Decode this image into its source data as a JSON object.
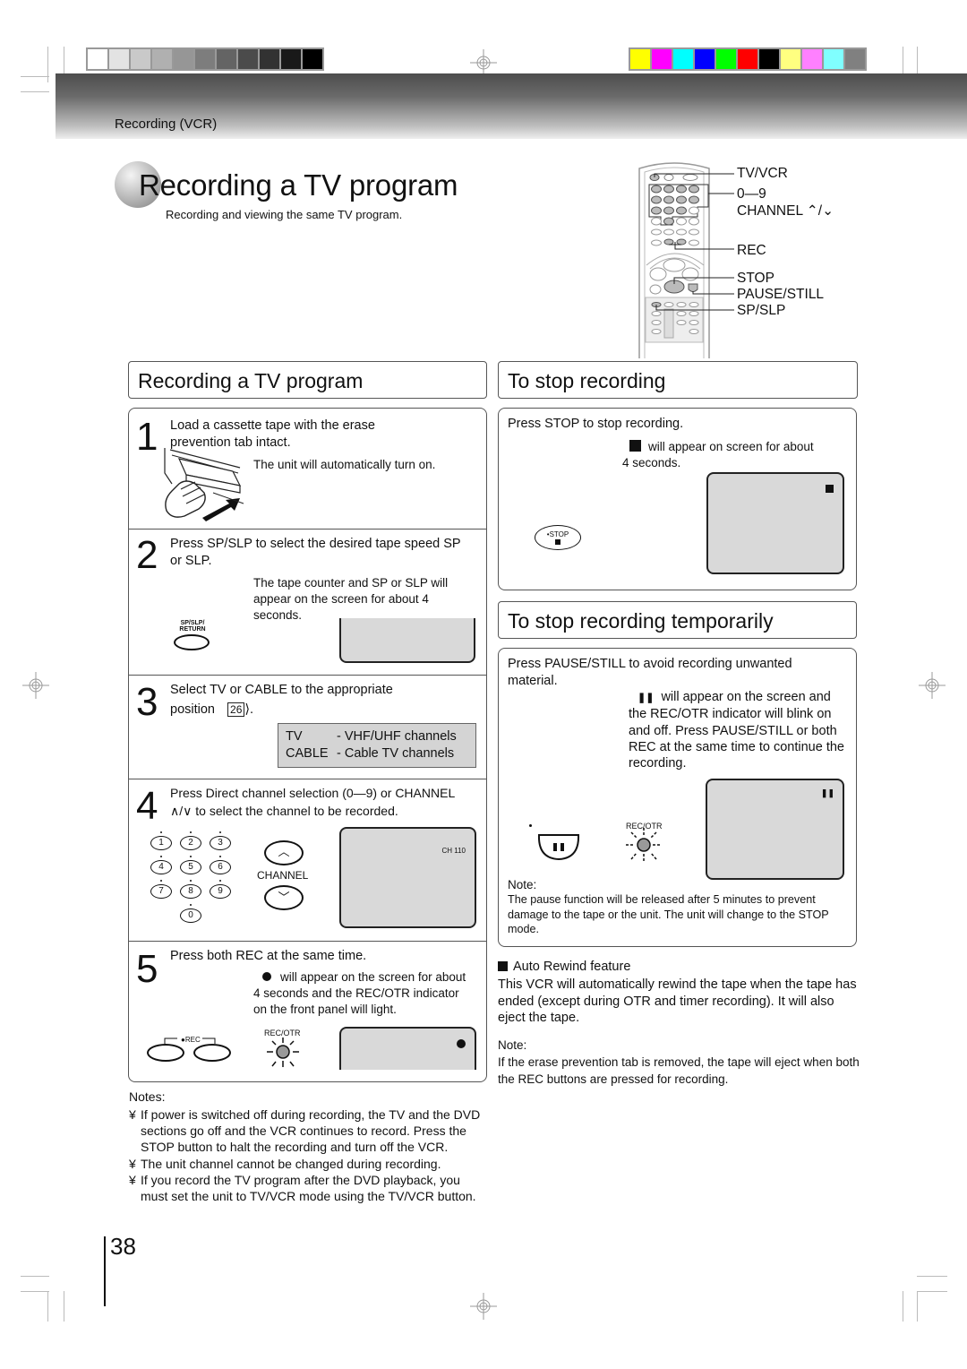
{
  "header": {
    "section_label": "Recording (VCR)",
    "grayscale_swatches": [
      "#ffffff",
      "#e3e3e3",
      "#c9c9c9",
      "#b0b0b0",
      "#969696",
      "#7d7d7d",
      "#646464",
      "#4b4b4b",
      "#323232",
      "#191919",
      "#000000"
    ],
    "color_swatches": [
      "#ffff00",
      "#ff00ff",
      "#00ffff",
      "#0000ff",
      "#00ff00",
      "#ff0000",
      "#000000",
      "#ffff80",
      "#ff80ff",
      "#80ffff",
      "#808080"
    ]
  },
  "title": {
    "main": "Recording a TV program",
    "subtitle": "Recording and viewing the same TV program."
  },
  "remote_labels": {
    "tv_vcr": "TV/VCR",
    "digits": "0—9",
    "channel": "CHANNEL ⌃/⌄",
    "rec": "REC",
    "stop": "STOP",
    "pause_still": "PAUSE/STILL",
    "sp_slp": "SP/SLP"
  },
  "recording_section": {
    "heading": "Recording a TV program",
    "steps": [
      {
        "number": "1",
        "text": "Load a cassette tape with the erase prevention tab intact.",
        "detail": "The unit will automatically turn on."
      },
      {
        "number": "2",
        "text": "Press SP/SLP to select the desired tape speed SP or SLP.",
        "detail": "The tape counter and SP or SLP will appear on the screen for about 4 seconds.",
        "button_label": "SP/SLP/ RETURN"
      },
      {
        "number": "3",
        "text_line1": "Select  TV  or  CABLE  to the appropriate",
        "text_line2": "position",
        "page_ref": "26",
        "options": [
          {
            "key": "TV",
            "desc": "- VHF/UHF channels"
          },
          {
            "key": "CABLE",
            "desc": "- Cable TV channels"
          }
        ]
      },
      {
        "number": "4",
        "text_line1": "Press Direct channel selection (0—9) or CHANNEL",
        "text_line2": "∧/∨ to select the channel to be recorded.",
        "keypad": [
          "1",
          "2",
          "3",
          "4",
          "5",
          "6",
          "7",
          "8",
          "9",
          "0"
        ],
        "channel_label": "CHANNEL",
        "screen_text": "CH  110"
      },
      {
        "number": "5",
        "text": "Press both REC at the same time.",
        "detail": "will appear on the screen for about 4 seconds and the REC/OTR indicator on the front panel will light.",
        "rec_label": "●REC",
        "indicator_label": "REC/OTR"
      }
    ]
  },
  "notes": {
    "heading": "Notes:",
    "bullet": "¥",
    "items": [
      "If power is switched off during recording, the TV and the DVD sections go off and the VCR continues to record. Press the STOP button to halt the recording and turn off the VCR.",
      "The unit channel cannot be changed during recording.",
      "If you record the TV program after the DVD playback, you must set the unit to TV/VCR mode using the TV/VCR button."
    ]
  },
  "stop_section": {
    "heading": "To stop recording",
    "text": "Press STOP to stop recording.",
    "detail_line1": "will appear on screen for about",
    "detail_line2": "4 seconds.",
    "button_label": "•STOP"
  },
  "pause_section": {
    "heading": "To stop recording temporarily",
    "text": "Press PAUSE/STILL to avoid recording unwanted material.",
    "detail": "will appear on the screen and the REC/OTR indicator will blink on and off. Press PAUSE/STILL  or both REC at the same time to continue the recording.",
    "indicator_label": "REC/OTR",
    "note_heading": "Note:",
    "note_text": "The pause function will be released after 5 minutes to prevent damage to the tape or the unit. The unit will change to the STOP mode."
  },
  "auto_rewind": {
    "heading": "Auto Rewind feature",
    "text": "This VCR will automatically rewind the tape when the tape has ended (except during OTR and timer recording). It will also eject the tape.",
    "note_heading": "Note:",
    "note_text": "If the erase prevention tab is removed, the tape will eject when both the REC buttons are pressed for recording."
  },
  "page_number": "38"
}
